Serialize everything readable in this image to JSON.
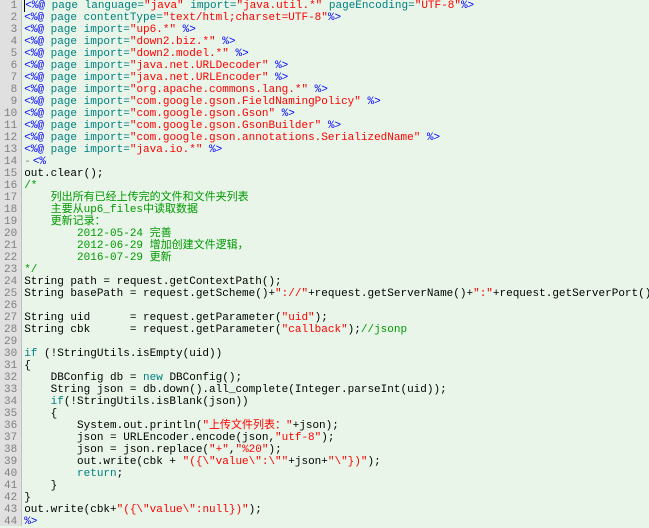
{
  "lines": [
    {
      "n": 1,
      "segs": [
        {
          "c": "tag",
          "t": "<%@ "
        },
        {
          "c": "keyword",
          "t": "page "
        },
        {
          "c": "attr",
          "t": "language="
        },
        {
          "c": "str",
          "t": "\"java\""
        },
        {
          "c": "attr",
          "t": " import="
        },
        {
          "c": "str",
          "t": "\"java.util.*\""
        },
        {
          "c": "attr",
          "t": " pageEncoding="
        },
        {
          "c": "str",
          "t": "\"UTF-8\""
        },
        {
          "c": "tag",
          "t": "%>"
        }
      ]
    },
    {
      "n": 2,
      "segs": [
        {
          "c": "tag",
          "t": "<%@ "
        },
        {
          "c": "keyword",
          "t": "page "
        },
        {
          "c": "attr",
          "t": "contentType="
        },
        {
          "c": "str",
          "t": "\"text/html;charset=UTF-8\""
        },
        {
          "c": "tag",
          "t": "%>"
        }
      ]
    },
    {
      "n": 3,
      "segs": [
        {
          "c": "tag",
          "t": "<%@ "
        },
        {
          "c": "keyword",
          "t": "page "
        },
        {
          "c": "attr",
          "t": "import="
        },
        {
          "c": "str",
          "t": "\"up6.*\""
        },
        {
          "c": "tag",
          "t": " %>"
        }
      ]
    },
    {
      "n": 4,
      "segs": [
        {
          "c": "tag",
          "t": "<%@ "
        },
        {
          "c": "keyword",
          "t": "page "
        },
        {
          "c": "attr",
          "t": "import="
        },
        {
          "c": "str",
          "t": "\"down2.biz.*\""
        },
        {
          "c": "tag",
          "t": " %>"
        }
      ]
    },
    {
      "n": 5,
      "segs": [
        {
          "c": "tag",
          "t": "<%@ "
        },
        {
          "c": "keyword",
          "t": "page "
        },
        {
          "c": "attr",
          "t": "import="
        },
        {
          "c": "str",
          "t": "\"down2.model.*\""
        },
        {
          "c": "tag",
          "t": " %>"
        }
      ]
    },
    {
      "n": 6,
      "segs": [
        {
          "c": "tag",
          "t": "<%@ "
        },
        {
          "c": "keyword",
          "t": "page "
        },
        {
          "c": "attr",
          "t": "import="
        },
        {
          "c": "str",
          "t": "\"java.net.URLDecoder\""
        },
        {
          "c": "tag",
          "t": " %>"
        }
      ]
    },
    {
      "n": 7,
      "segs": [
        {
          "c": "tag",
          "t": "<%@ "
        },
        {
          "c": "keyword",
          "t": "page "
        },
        {
          "c": "attr",
          "t": "import="
        },
        {
          "c": "str",
          "t": "\"java.net.URLEncoder\""
        },
        {
          "c": "tag",
          "t": " %>"
        }
      ]
    },
    {
      "n": 8,
      "segs": [
        {
          "c": "tag",
          "t": "<%@ "
        },
        {
          "c": "keyword",
          "t": "page "
        },
        {
          "c": "attr",
          "t": "import="
        },
        {
          "c": "str",
          "t": "\"org.apache.commons.lang.*\""
        },
        {
          "c": "tag",
          "t": " %>"
        }
      ]
    },
    {
      "n": 9,
      "segs": [
        {
          "c": "tag",
          "t": "<%@ "
        },
        {
          "c": "keyword",
          "t": "page "
        },
        {
          "c": "attr",
          "t": "import="
        },
        {
          "c": "str",
          "t": "\"com.google.gson.FieldNamingPolicy\""
        },
        {
          "c": "tag",
          "t": " %>"
        }
      ]
    },
    {
      "n": 10,
      "segs": [
        {
          "c": "tag",
          "t": "<%@ "
        },
        {
          "c": "keyword",
          "t": "page "
        },
        {
          "c": "attr",
          "t": "import="
        },
        {
          "c": "str",
          "t": "\"com.google.gson.Gson\""
        },
        {
          "c": "tag",
          "t": " %>"
        }
      ]
    },
    {
      "n": 11,
      "segs": [
        {
          "c": "tag",
          "t": "<%@ "
        },
        {
          "c": "keyword",
          "t": "page "
        },
        {
          "c": "attr",
          "t": "import="
        },
        {
          "c": "str",
          "t": "\"com.google.gson.GsonBuilder\""
        },
        {
          "c": "tag",
          "t": " %>"
        }
      ]
    },
    {
      "n": 12,
      "segs": [
        {
          "c": "tag",
          "t": "<%@ "
        },
        {
          "c": "keyword",
          "t": "page "
        },
        {
          "c": "attr",
          "t": "import="
        },
        {
          "c": "str",
          "t": "\"com.google.gson.annotations.SerializedName\""
        },
        {
          "c": "tag",
          "t": " %>"
        }
      ]
    },
    {
      "n": 13,
      "segs": [
        {
          "c": "tag",
          "t": "<%@ "
        },
        {
          "c": "keyword",
          "t": "page "
        },
        {
          "c": "attr",
          "t": "import="
        },
        {
          "c": "str",
          "t": "\"java.io.*\""
        },
        {
          "c": "tag",
          "t": " %>"
        }
      ]
    },
    {
      "n": 14,
      "segs": [
        {
          "c": "tag",
          "t": "<%"
        }
      ],
      "fold": true
    },
    {
      "n": 15,
      "segs": [
        {
          "c": "text",
          "t": "out.clear();"
        }
      ]
    },
    {
      "n": 16,
      "segs": [
        {
          "c": "comment",
          "t": "/*"
        }
      ]
    },
    {
      "n": 17,
      "segs": [
        {
          "c": "comment",
          "t": "    列出所有已经上传完的文件和文件夹列表"
        }
      ]
    },
    {
      "n": 18,
      "segs": [
        {
          "c": "comment",
          "t": "    主要从up6_files中读取数据"
        }
      ]
    },
    {
      "n": 19,
      "segs": [
        {
          "c": "comment",
          "t": "    更新记录："
        }
      ]
    },
    {
      "n": 20,
      "segs": [
        {
          "c": "comment",
          "t": "        2012-05-24 完善"
        }
      ]
    },
    {
      "n": 21,
      "segs": [
        {
          "c": "comment",
          "t": "        2012-06-29 增加创建文件逻辑，"
        }
      ]
    },
    {
      "n": 22,
      "segs": [
        {
          "c": "comment",
          "t": "        2016-07-29 更新"
        }
      ]
    },
    {
      "n": 23,
      "segs": [
        {
          "c": "comment",
          "t": "*/"
        }
      ]
    },
    {
      "n": 24,
      "segs": [
        {
          "c": "text",
          "t": "String path = request.getContextPath();"
        }
      ]
    },
    {
      "n": 25,
      "segs": [
        {
          "c": "text",
          "t": "String basePath = request.getScheme()+"
        },
        {
          "c": "str",
          "t": "\"://\""
        },
        {
          "c": "text",
          "t": "+request.getServerName()+"
        },
        {
          "c": "str",
          "t": "\":\""
        },
        {
          "c": "text",
          "t": "+request.getServerPort()+path+"
        },
        {
          "c": "str",
          "t": "\"/\""
        },
        {
          "c": "text",
          "t": ";"
        }
      ]
    },
    {
      "n": 26,
      "segs": [
        {
          "c": "text",
          "t": ""
        }
      ]
    },
    {
      "n": 27,
      "segs": [
        {
          "c": "text",
          "t": "String uid      = request.getParameter("
        },
        {
          "c": "str",
          "t": "\"uid\""
        },
        {
          "c": "text",
          "t": ");"
        }
      ]
    },
    {
      "n": 28,
      "segs": [
        {
          "c": "text",
          "t": "String cbk      = request.getParameter("
        },
        {
          "c": "str",
          "t": "\"callback\""
        },
        {
          "c": "text",
          "t": ");"
        },
        {
          "c": "comment",
          "t": "//jsonp"
        }
      ]
    },
    {
      "n": 29,
      "segs": [
        {
          "c": "text",
          "t": ""
        }
      ]
    },
    {
      "n": 30,
      "segs": [
        {
          "c": "keyword",
          "t": "if"
        },
        {
          "c": "text",
          "t": " (!StringUtils.isEmpty(uid))"
        }
      ]
    },
    {
      "n": 31,
      "segs": [
        {
          "c": "text",
          "t": "{"
        }
      ]
    },
    {
      "n": 32,
      "segs": [
        {
          "c": "text",
          "t": "    DBConfig db = "
        },
        {
          "c": "keyword",
          "t": "new"
        },
        {
          "c": "text",
          "t": " DBConfig();"
        }
      ]
    },
    {
      "n": 33,
      "segs": [
        {
          "c": "text",
          "t": "    String json = db.down().all_complete(Integer.parseInt(uid));"
        }
      ]
    },
    {
      "n": 34,
      "segs": [
        {
          "c": "text",
          "t": "    "
        },
        {
          "c": "keyword",
          "t": "if"
        },
        {
          "c": "text",
          "t": "(!StringUtils.isBlank(json))"
        }
      ]
    },
    {
      "n": 35,
      "segs": [
        {
          "c": "text",
          "t": "    {"
        }
      ]
    },
    {
      "n": 36,
      "segs": [
        {
          "c": "text",
          "t": "        System.out.println("
        },
        {
          "c": "str",
          "t": "\"上传文件列表：\""
        },
        {
          "c": "text",
          "t": "+json);"
        }
      ]
    },
    {
      "n": 37,
      "segs": [
        {
          "c": "text",
          "t": "        json = URLEncoder.encode(json,"
        },
        {
          "c": "str",
          "t": "\"utf-8\""
        },
        {
          "c": "text",
          "t": ");"
        }
      ]
    },
    {
      "n": 38,
      "segs": [
        {
          "c": "text",
          "t": "        json = json.replace("
        },
        {
          "c": "str",
          "t": "\"+\""
        },
        {
          "c": "text",
          "t": ","
        },
        {
          "c": "str",
          "t": "\"%20\""
        },
        {
          "c": "text",
          "t": ");"
        }
      ]
    },
    {
      "n": 39,
      "segs": [
        {
          "c": "text",
          "t": "        out.write(cbk + "
        },
        {
          "c": "str",
          "t": "\"({\\\"value\\\":\\\"\""
        },
        {
          "c": "text",
          "t": "+json+"
        },
        {
          "c": "str",
          "t": "\"\\\"})\""
        },
        {
          "c": "text",
          "t": ");"
        }
      ]
    },
    {
      "n": 40,
      "segs": [
        {
          "c": "text",
          "t": "        "
        },
        {
          "c": "keyword",
          "t": "return"
        },
        {
          "c": "text",
          "t": ";"
        }
      ]
    },
    {
      "n": 41,
      "segs": [
        {
          "c": "text",
          "t": "    }"
        }
      ]
    },
    {
      "n": 42,
      "segs": [
        {
          "c": "text",
          "t": "}"
        }
      ]
    },
    {
      "n": 43,
      "segs": [
        {
          "c": "text",
          "t": "out.write(cbk+"
        },
        {
          "c": "str",
          "t": "\"({\\\"value\\\":null})\""
        },
        {
          "c": "text",
          "t": ");"
        }
      ]
    },
    {
      "n": 44,
      "segs": [
        {
          "c": "tag",
          "t": "%>"
        }
      ]
    }
  ]
}
